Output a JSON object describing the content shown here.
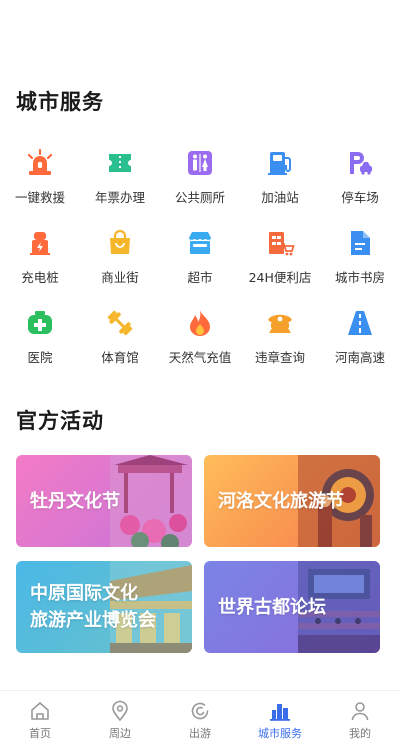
{
  "city_services": {
    "title": "城市服务",
    "items": [
      {
        "label": "一键救援",
        "icon": "siren-icon",
        "color": "#ff6a3d"
      },
      {
        "label": "年票办理",
        "icon": "ticket-icon",
        "color": "#2bbf8f"
      },
      {
        "label": "公共厕所",
        "icon": "restroom-icon",
        "color": "#9b6cf0"
      },
      {
        "label": "加油站",
        "icon": "gas-pump-icon",
        "color": "#3a8ff0"
      },
      {
        "label": "停车场",
        "icon": "parking-icon",
        "color": "#8a6cf0"
      },
      {
        "label": "充电桩",
        "icon": "charging-pile-icon",
        "color": "#ff6a3d"
      },
      {
        "label": "商业街",
        "icon": "shopping-bag-icon",
        "color": "#f5b62a"
      },
      {
        "label": "超市",
        "icon": "supermarket-icon",
        "color": "#3aaaf0"
      },
      {
        "label": "24H便利店",
        "icon": "convenience-store-icon",
        "color": "#f56a3d"
      },
      {
        "label": "城市书房",
        "icon": "document-icon",
        "color": "#3a8ff0"
      },
      {
        "label": "医院",
        "icon": "hospital-cross-icon",
        "color": "#2bbf5f"
      },
      {
        "label": "体育馆",
        "icon": "dumbbell-icon",
        "color": "#f5b62a"
      },
      {
        "label": "天然气充值",
        "icon": "flame-icon",
        "color": "#ff6a3d"
      },
      {
        "label": "违章查询",
        "icon": "police-cap-icon",
        "color": "#f5a02a"
      },
      {
        "label": "河南高速",
        "icon": "highway-icon",
        "color": "#3a8ff0"
      }
    ]
  },
  "official_activities": {
    "title": "官方活动",
    "cards": [
      {
        "text": "牡丹文化节",
        "gradient_from": "#f27bc6",
        "gradient_to": "#c774d9"
      },
      {
        "text": "河洛文化旅游节",
        "gradient_from": "#ffbd5a",
        "gradient_to": "#f57a4a"
      },
      {
        "text": "中原国际文化旅游产业博览会",
        "gradient_from": "#4ab8e6",
        "gradient_to": "#6cc3c9"
      },
      {
        "text": "世界古都论坛",
        "gradient_from": "#7b84e6",
        "gradient_to": "#8a6cd9"
      }
    ]
  },
  "tabbar": {
    "active_color": "#3a6ee8",
    "tabs": [
      {
        "label": "首页",
        "icon": "home-icon"
      },
      {
        "label": "周边",
        "icon": "location-pin-icon"
      },
      {
        "label": "出游",
        "icon": "travel-swirl-icon"
      },
      {
        "label": "城市服务",
        "icon": "city-buildings-icon",
        "active": true
      },
      {
        "label": "我的",
        "icon": "profile-icon"
      }
    ]
  }
}
